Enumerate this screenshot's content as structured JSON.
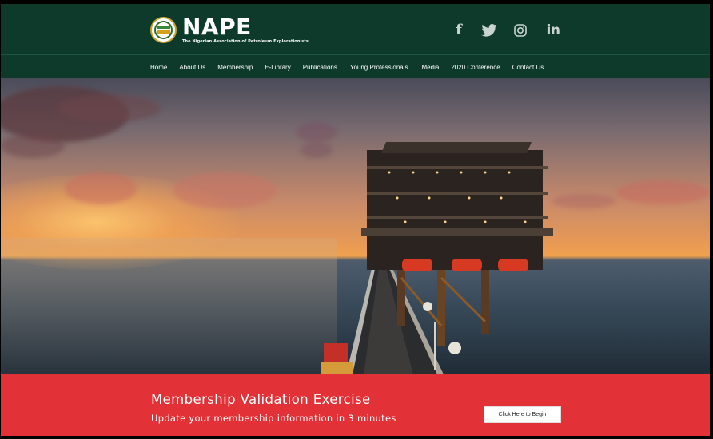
{
  "header": {
    "brand_name": "NAPE",
    "brand_subtitle": "The Nigerian Association of Petroleum Explorationists",
    "social": [
      "facebook-icon",
      "twitter-icon",
      "instagram-icon",
      "linkedin-icon"
    ]
  },
  "nav": {
    "items": [
      {
        "label": "Home"
      },
      {
        "label": "About Us"
      },
      {
        "label": "Membership"
      },
      {
        "label": "E-Library"
      },
      {
        "label": "Publications"
      },
      {
        "label": "Young Professionals"
      },
      {
        "label": "Media"
      },
      {
        "label": "2020 Conference"
      },
      {
        "label": "Contact Us"
      }
    ]
  },
  "hero": {
    "image": "offshore-oil-rig-at-sunset"
  },
  "cta": {
    "title": "Membership Validation Exercise",
    "subtitle": "Update your membership information in 3 minutes",
    "button_label": "Click Here to Begin"
  },
  "colors": {
    "header_bg": "#0e3a2c",
    "cta_bg": "#e23237",
    "button_bg": "#ffffff"
  }
}
